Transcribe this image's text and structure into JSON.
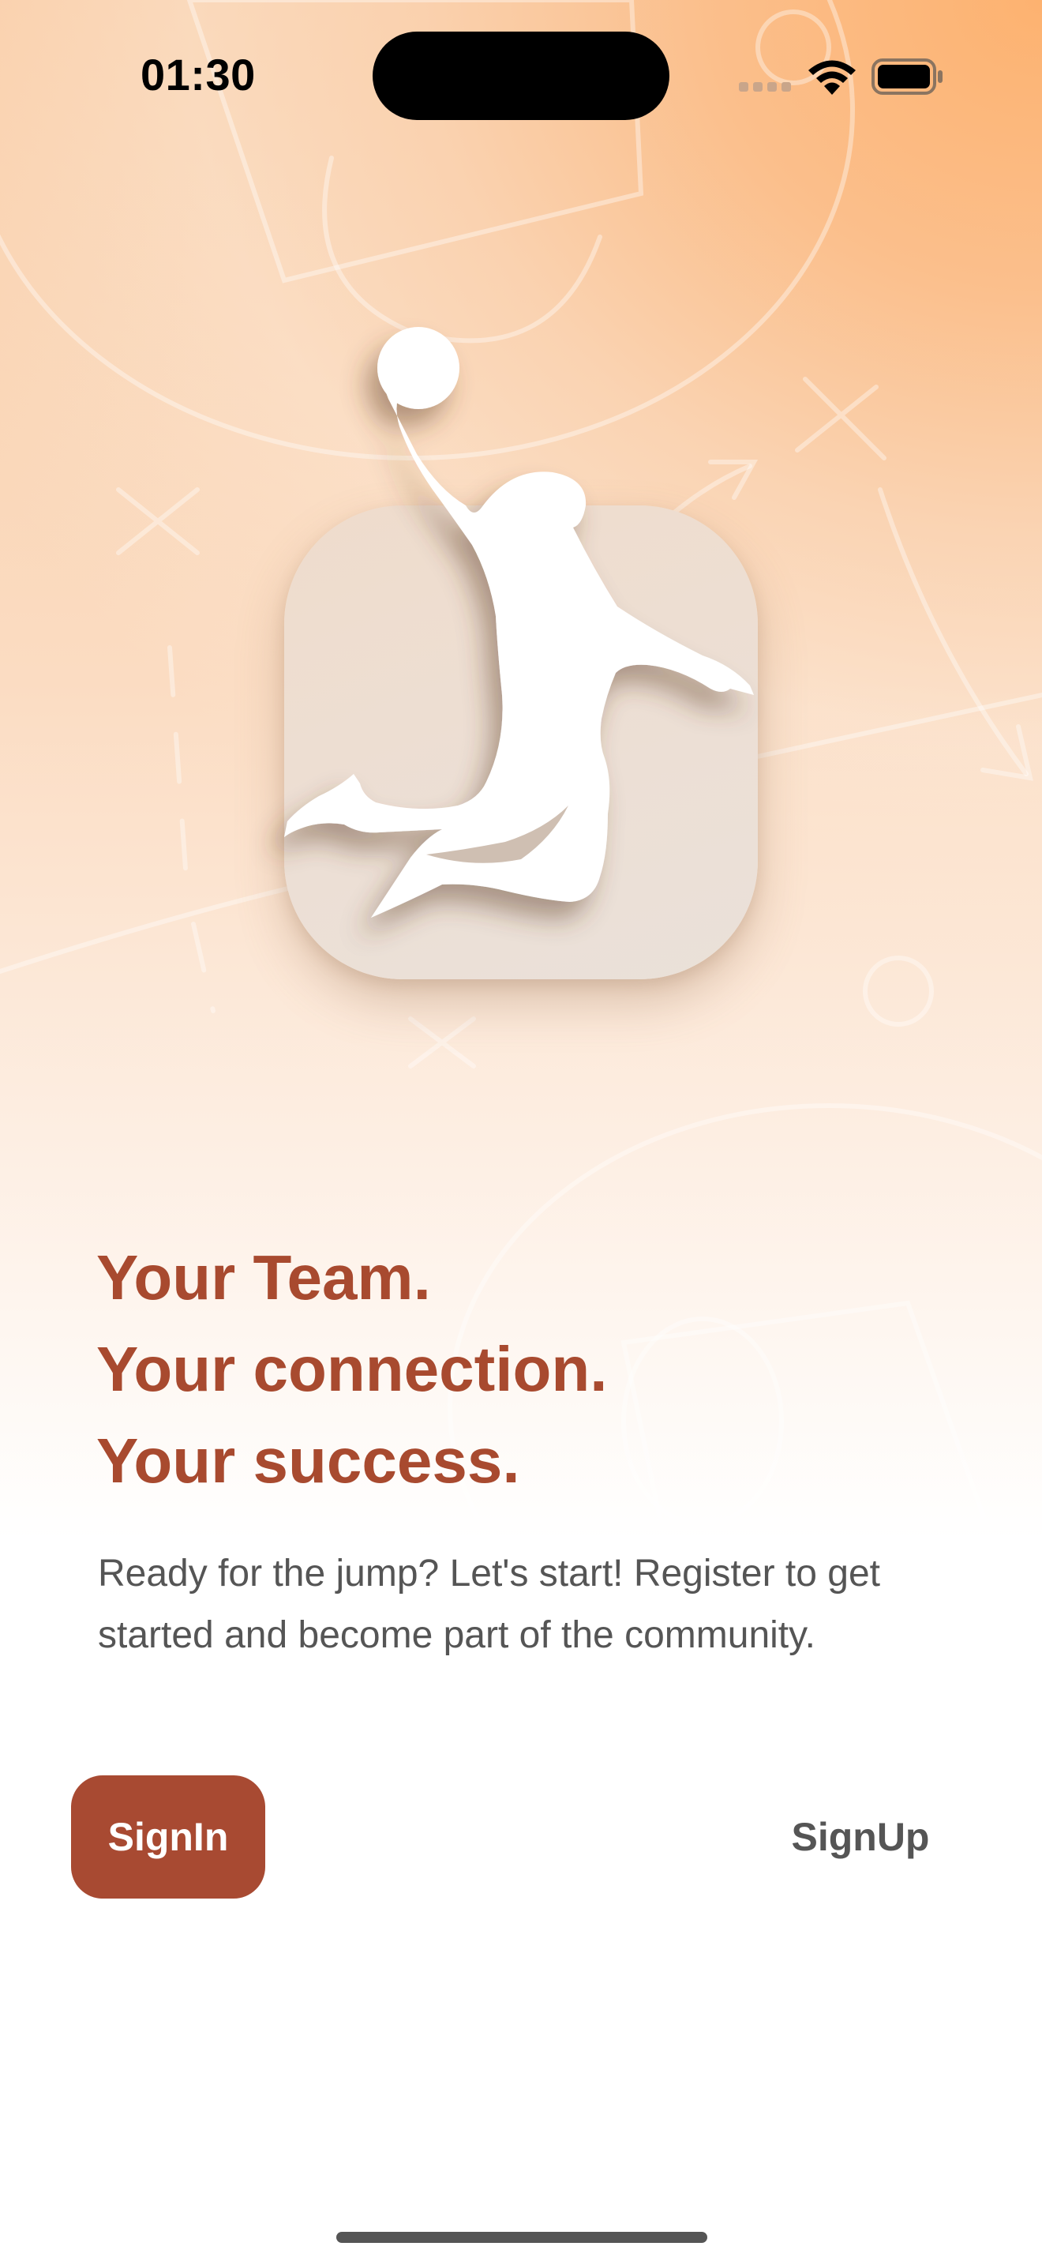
{
  "status_bar": {
    "time": "01:30",
    "icons": [
      "cellular-signal-icon",
      "wifi-icon",
      "battery-icon"
    ]
  },
  "app_icon": {
    "icon": "basketball-player-dunk-icon"
  },
  "welcome": {
    "headline_line_1": "Your Team.",
    "headline_line_2": "Your connection.",
    "headline_line_3": "Your success.",
    "description": "Ready for the jump? Let's start! Register to get started and become part of the community."
  },
  "actions": {
    "signin_label": "SignIn",
    "signup_label": "SignUp"
  },
  "colors": {
    "accent": "#a84a32",
    "headline": "#a84a2f",
    "body_text": "#555555",
    "background_top": "#fdb270",
    "background_bottom": "#ffffff"
  }
}
